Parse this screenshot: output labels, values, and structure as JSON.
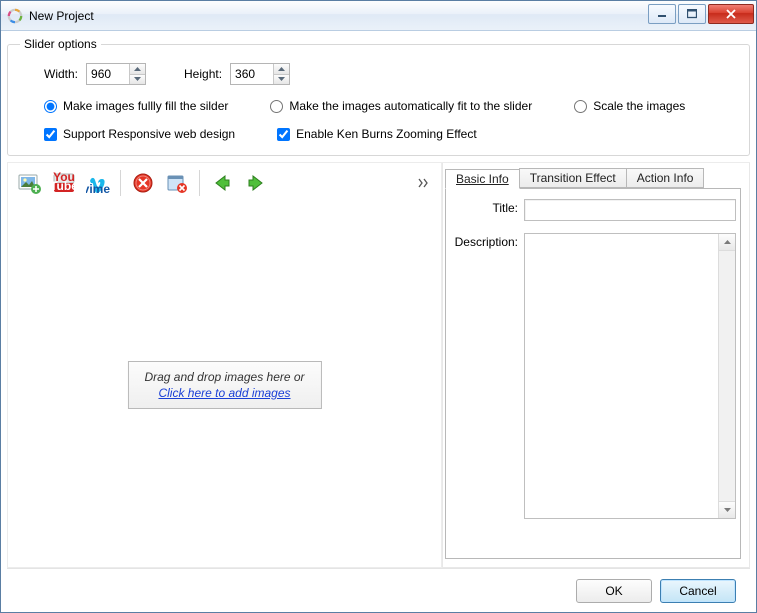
{
  "window": {
    "title": "New Project"
  },
  "slider_options": {
    "legend": "Slider options",
    "width_label": "Width:",
    "width_value": "960",
    "height_label": "Height:",
    "height_value": "360",
    "fit_mode": {
      "full_fill": "Make images fullly fill the silder",
      "auto_fit": "Make the images automatically fit to the slider",
      "scale": "Scale the images"
    },
    "responsive_label": "Support Responsive web design",
    "kenburns_label": "Enable Ken Burns Zooming Effect"
  },
  "toolbar": {
    "icons": [
      "add-image-icon",
      "youtube-icon",
      "vimeo-icon",
      "delete-icon",
      "delete-all-icon",
      "arrow-left-icon",
      "arrow-right-icon",
      "more-icon"
    ]
  },
  "dropzone": {
    "line1": "Drag and drop images here or",
    "link": "Click here to add images"
  },
  "tabs": {
    "basic": "Basic Info",
    "transition": "Transition Effect",
    "action": "Action Info"
  },
  "basic_info": {
    "title_label": "Title:",
    "title_value": "",
    "desc_label": "Description:",
    "desc_value": ""
  },
  "footer": {
    "ok": "OK",
    "cancel": "Cancel"
  }
}
